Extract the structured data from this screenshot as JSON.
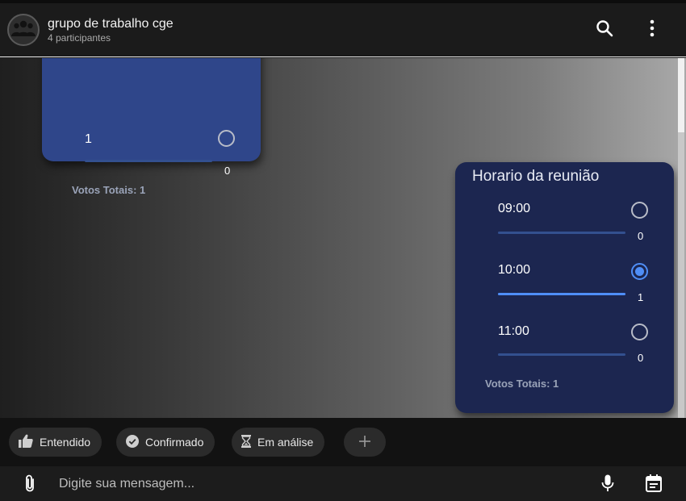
{
  "header": {
    "title": "grupo de trabalho cge",
    "subtitle": "4 participantes",
    "icons": [
      "group-icon",
      "search-icon",
      "more-vertical-icon"
    ]
  },
  "colors": {
    "accent": "#4f8ef7",
    "card_top_bg": "#2f468a",
    "card_poll_bg": "#1c2650"
  },
  "previous_poll": {
    "option": {
      "label": "1",
      "count": "0",
      "selected": false,
      "fraction": 0
    },
    "total": "Votos Totais: 1"
  },
  "poll": {
    "question": "Horario da reunião",
    "options": [
      {
        "label": "09:00",
        "count": "0",
        "selected": false,
        "fraction": 0
      },
      {
        "label": "10:00",
        "count": "1",
        "selected": true,
        "fraction": 1
      },
      {
        "label": "11:00",
        "count": "0",
        "selected": false,
        "fraction": 0
      }
    ],
    "total": "Votos Totais: 1"
  },
  "quick_replies": [
    {
      "label": "Entendido",
      "icon": "thumbs-up-icon"
    },
    {
      "label": "Confirmado",
      "icon": "check-circle-icon"
    },
    {
      "label": "Em análise",
      "icon": "hourglass-icon"
    }
  ],
  "add_reply_icon": "plus-icon",
  "composer": {
    "placeholder": "Digite sua mensagem...",
    "icons": [
      "attach-icon",
      "microphone-icon",
      "calendar-icon"
    ]
  }
}
